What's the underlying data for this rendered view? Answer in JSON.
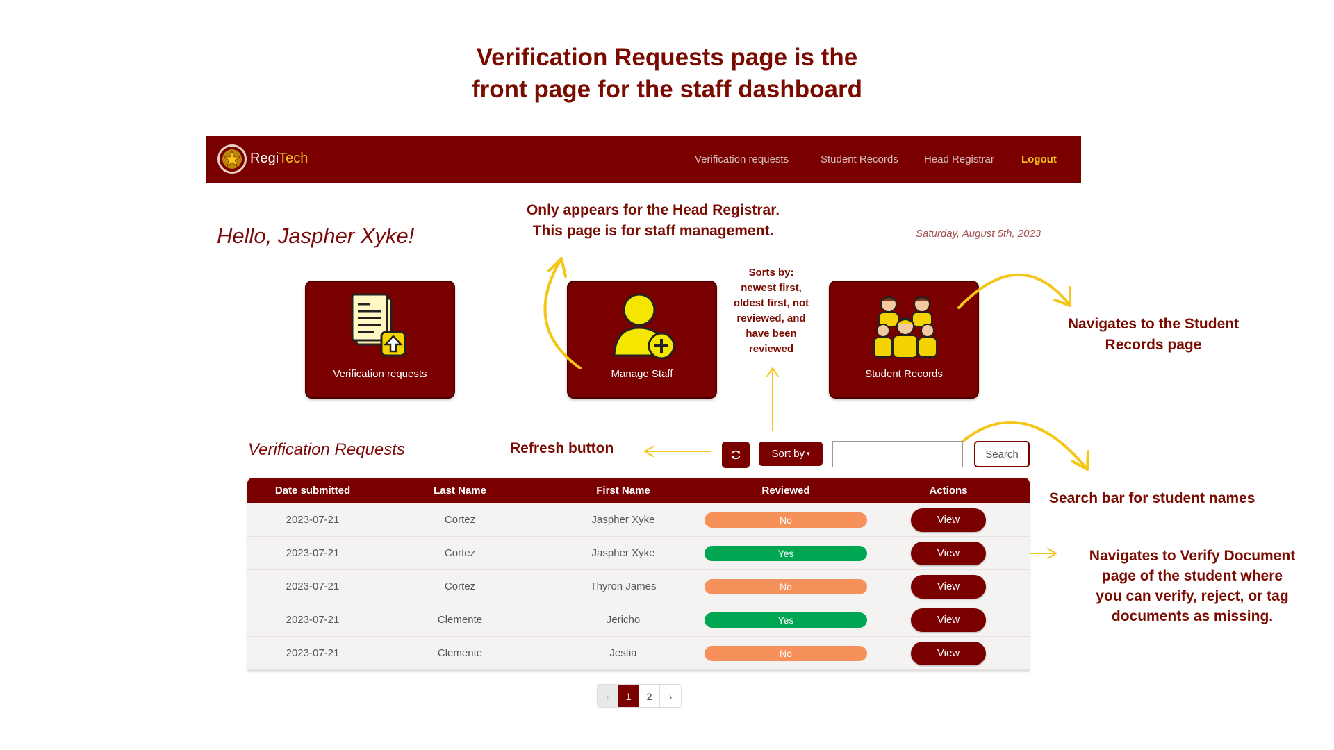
{
  "headline": {
    "line1": "Verification Requests page is the",
    "line2": "front page for the staff dashboard"
  },
  "navbar": {
    "brand_prefix": "Regi",
    "brand_suffix": "Tech",
    "links": [
      "Verification requests",
      "Student Records",
      "Head Registrar"
    ],
    "logout": "Logout"
  },
  "greeting": "Hello, Jaspher Xyke!",
  "date": "Saturday, August 5th, 2023",
  "cards": [
    {
      "label": "Verification requests",
      "icon": "document-upload-icon"
    },
    {
      "label": "Manage Staff",
      "icon": "add-user-icon"
    },
    {
      "label": "Student Records",
      "icon": "students-group-icon"
    }
  ],
  "annotations": {
    "head_registrar_line1": "Only appears for the Head Registrar.",
    "head_registrar_line2": "This page is for staff management.",
    "sorts_by": [
      "Sorts by:",
      "newest first,",
      "oldest first, not",
      "reviewed, and",
      "have been",
      "reviewed"
    ],
    "student_records_line1": "Navigates to the Student",
    "student_records_line2": "Records page",
    "refresh": "Refresh button",
    "search": "Search bar for student names",
    "verify": [
      "Navigates to Verify Document",
      "page of the student where",
      "you can verify, reject, or tag",
      "documents as missing."
    ]
  },
  "section_title": "Verification Requests",
  "toolbar": {
    "sort_label": "Sort by",
    "search_placeholder": "",
    "search_label": "Search",
    "refresh_icon": "refresh-icon"
  },
  "table": {
    "headers": [
      "Date submitted",
      "Last Name",
      "First Name",
      "Reviewed",
      "Actions"
    ],
    "rows": [
      {
        "date": "2023-07-21",
        "last": "Cortez",
        "first": "Jaspher Xyke",
        "reviewed": "No",
        "action": "View"
      },
      {
        "date": "2023-07-21",
        "last": "Cortez",
        "first": "Jaspher Xyke",
        "reviewed": "Yes",
        "action": "View"
      },
      {
        "date": "2023-07-21",
        "last": "Cortez",
        "first": "Thyron James",
        "reviewed": "No",
        "action": "View"
      },
      {
        "date": "2023-07-21",
        "last": "Clemente",
        "first": "Jericho",
        "reviewed": "Yes",
        "action": "View"
      },
      {
        "date": "2023-07-21",
        "last": "Clemente",
        "first": "Jestia",
        "reviewed": "No",
        "action": "View"
      }
    ]
  },
  "pagination": {
    "prev": "‹",
    "pages": [
      "1",
      "2"
    ],
    "next": "›",
    "current": "1"
  },
  "colors": {
    "primary": "#7a0000",
    "accent": "#f5c518",
    "no_badge": "#f6915b",
    "yes_badge": "#00a651",
    "annotation": "#7a0b00"
  }
}
